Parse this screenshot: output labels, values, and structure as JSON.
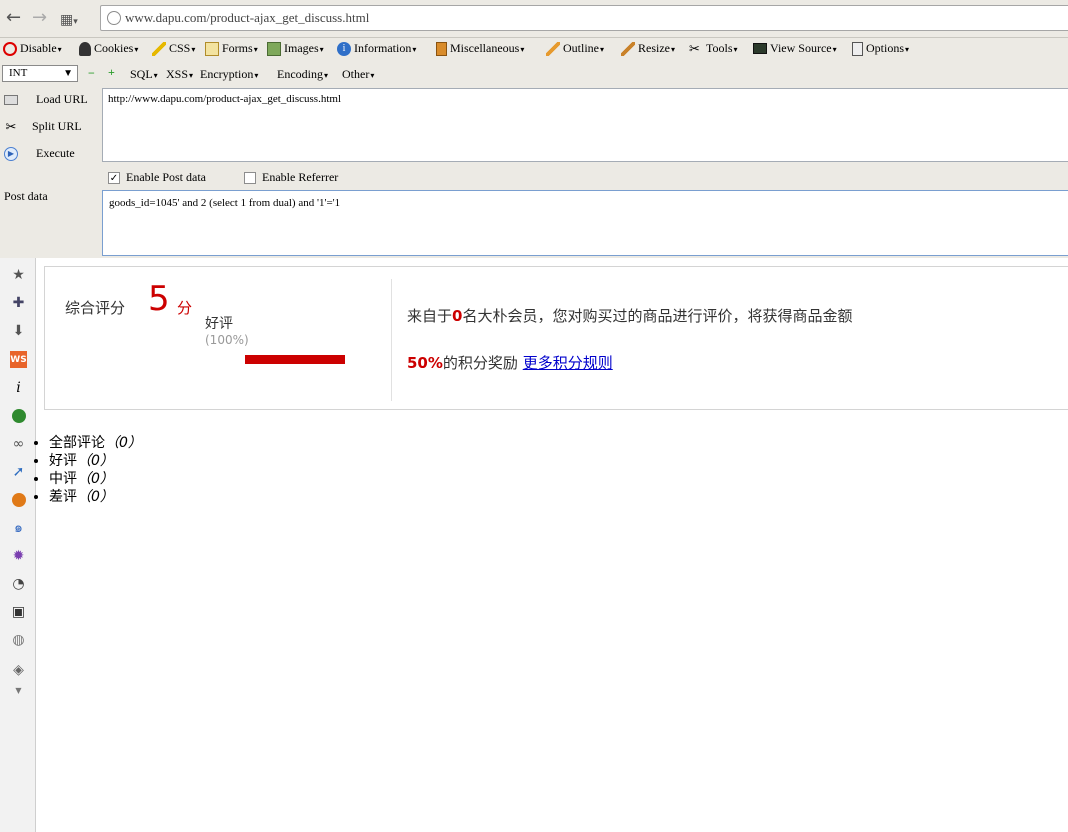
{
  "navbar": {
    "url": "www.dapu.com/product-ajax_get_discuss.html"
  },
  "webdev_toolbar": {
    "items": [
      "Disable",
      "Cookies",
      "CSS",
      "Forms",
      "Images",
      "Information",
      "Miscellaneous",
      "Outline",
      "Resize",
      "Tools",
      "View Source",
      "Options"
    ]
  },
  "hackbar_toolbar": {
    "select_value": "INT",
    "items": [
      "SQL",
      "XSS",
      "Encryption",
      "Encoding",
      "Other"
    ]
  },
  "hackbar": {
    "load_url": "Load URL",
    "split_url": "Split URL",
    "execute": "Execute",
    "url_value": "http://www.dapu.com/product-ajax_get_discuss.html",
    "enable_post": "Enable Post data",
    "enable_post_checked": true,
    "enable_referrer": "Enable Referrer",
    "enable_referrer_checked": false,
    "post_label": "Post data",
    "post_value": "goods_id=1045' and 2 (select 1 from dual) and '1'='1"
  },
  "sidebar": {
    "icons": [
      "star-icon",
      "puzzle-icon",
      "download-arrow-icon",
      "ws-icon",
      "info-icon",
      "green-ball-icon",
      "link-chain-icon",
      "cursor-select-icon",
      "warning-face-icon",
      "swirl-icon",
      "purple-gear-icon",
      "palette-icon",
      "grid-icon",
      "globe-icon",
      "eraser-icon"
    ]
  },
  "review": {
    "title": "综合评分",
    "score": "5",
    "unit": "分",
    "good_label": "好评",
    "good_pct_text": "(100%)",
    "good_fraction": 1.0,
    "desc_part1": "来自于",
    "member_count": "0",
    "desc_part2": "名大朴会员，您对购买过的商品进行评价，将获得商品金额",
    "bonus_pct": "50%",
    "desc_part3": "的积分奖励",
    "more_link": "更多积分规则"
  },
  "tabs": [
    {
      "label": "全部评论",
      "count": "（0）"
    },
    {
      "label": "好评",
      "count": "（0）"
    },
    {
      "label": "中评",
      "count": "（0）"
    },
    {
      "label": "差评",
      "count": "（0）"
    }
  ]
}
